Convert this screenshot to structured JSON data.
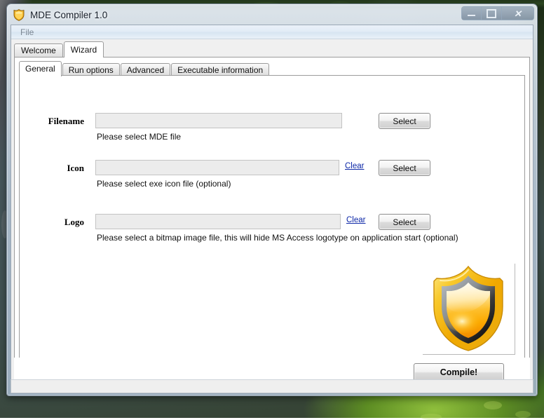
{
  "window": {
    "title": "MDE Compiler 1.0",
    "app_icon": "shield-icon",
    "minimize_label": "Minimize",
    "maximize_label": "Maximize",
    "close_label": "Close"
  },
  "menubar": {
    "items": [
      {
        "label": "File"
      }
    ]
  },
  "outer_tabs": [
    {
      "label": "Welcome",
      "active": false
    },
    {
      "label": "Wizard",
      "active": true
    }
  ],
  "inner_tabs": [
    {
      "label": "General",
      "active": true
    },
    {
      "label": "Run options",
      "active": false
    },
    {
      "label": "Advanced",
      "active": false
    },
    {
      "label": "Executable information",
      "active": false
    }
  ],
  "form": {
    "rows": [
      {
        "label": "Filename",
        "value": "",
        "placeholder": "",
        "hint": "Please select MDE file",
        "clear_label": "",
        "has_clear": false,
        "select_label": "Select"
      },
      {
        "label": "Icon",
        "value": "",
        "placeholder": "",
        "hint": "Please select exe icon file (optional)",
        "clear_label": "Clear",
        "has_clear": true,
        "select_label": "Select"
      },
      {
        "label": "Logo",
        "value": "",
        "placeholder": "",
        "hint": "Please select a bitmap image file, this will hide MS Access logotype on application start (optional)",
        "clear_label": "Clear",
        "has_clear": true,
        "select_label": "Select"
      }
    ]
  },
  "preview": {
    "name": "shield-logo-preview",
    "alt": "Gold and black shield logo"
  },
  "actions": {
    "compile_label": "Compile!"
  },
  "statusbar": {
    "text": ""
  },
  "colors": {
    "link": "#0c27a7",
    "shield_gold": "#f5c518",
    "shield_orange": "#f8a000",
    "shield_dark": "#1a1a1a",
    "field_bg": "#ececec",
    "panel_bg": "#ffffff"
  }
}
